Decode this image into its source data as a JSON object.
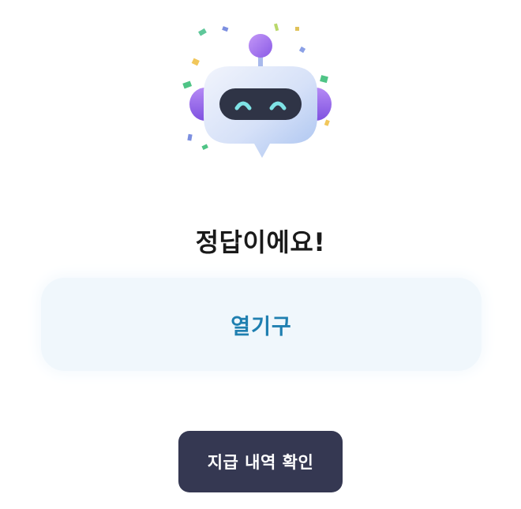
{
  "mascot": {
    "icon": "robot-mascot-icon",
    "colors": {
      "head_light": "#dfe8fb",
      "head_shade": "#b7c8f5",
      "ears": "#9b6bef",
      "visor": "#2f3446",
      "eyes": "#7fe3e6"
    }
  },
  "result": {
    "title": "정답이에요!"
  },
  "answer": {
    "text": "열기구"
  },
  "actions": {
    "history_label": "지급 내역 확인"
  },
  "colors": {
    "accent": "#1f7fb0",
    "card_bg": "#f0f7fc",
    "button_bg": "#353852",
    "title_text": "#1a1a1a"
  }
}
